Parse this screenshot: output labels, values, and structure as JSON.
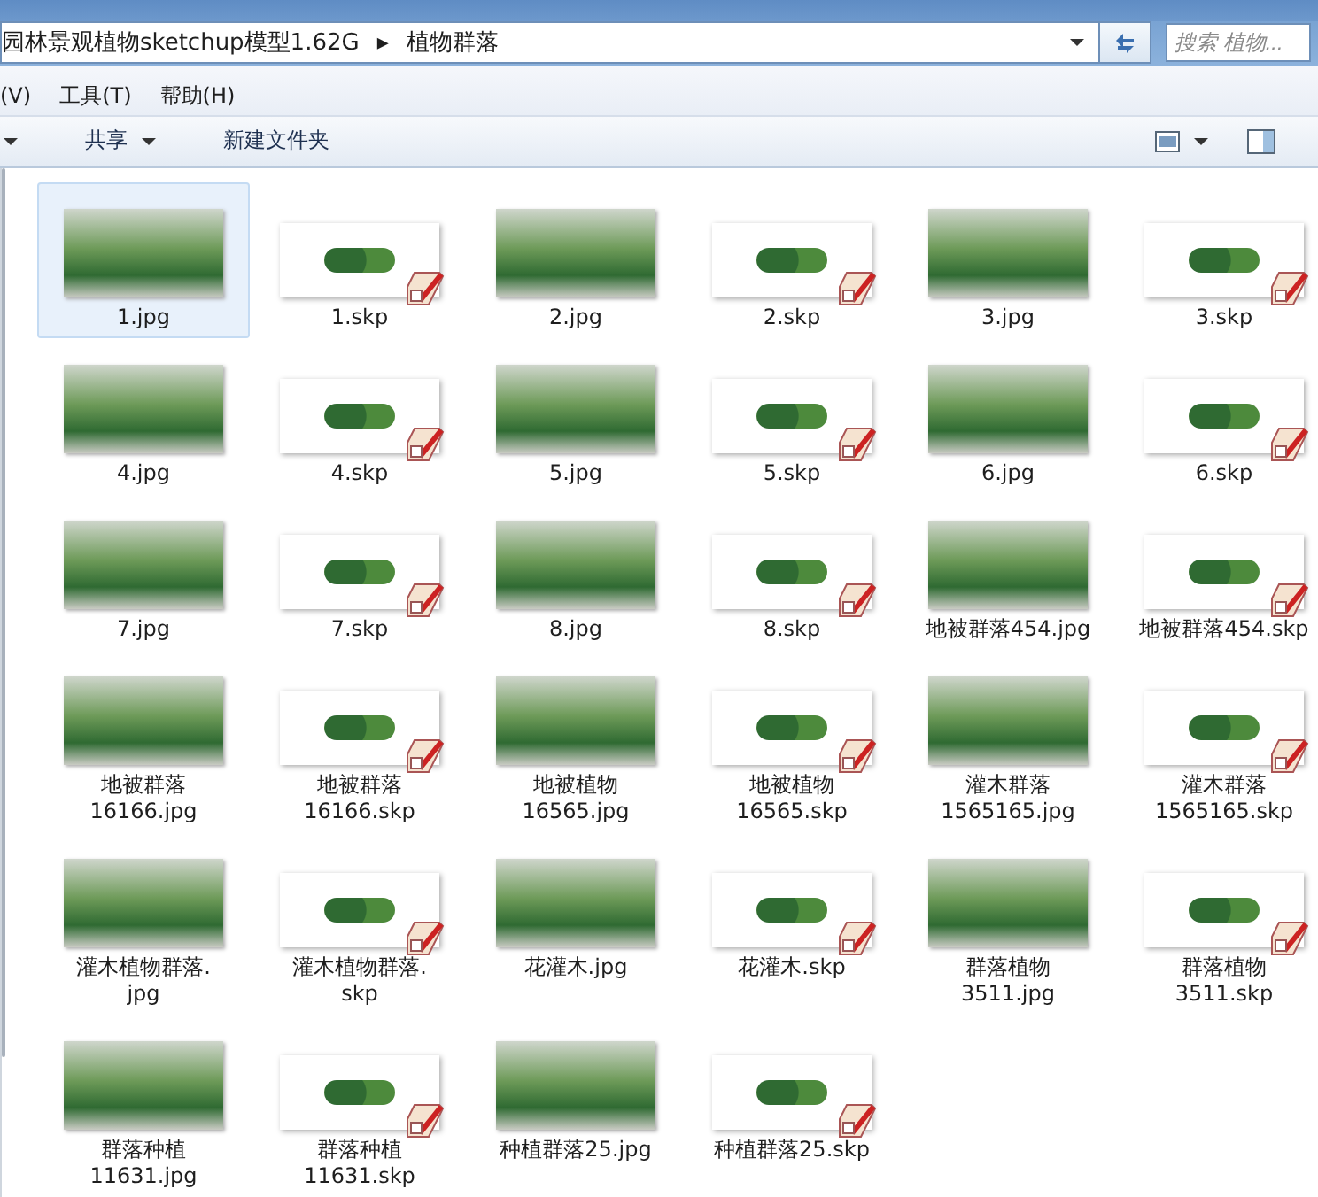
{
  "address_bar": {
    "crumbs": [
      "园林景观植物sketchup模型1.62G",
      "植物群落"
    ],
    "separator": "▸"
  },
  "search": {
    "placeholder": "搜索 植物..."
  },
  "menu_bar": [
    "(V)",
    "工具(T)",
    "帮助(H)"
  ],
  "toolbar": [
    {
      "label": "共享",
      "dropdown": true
    },
    {
      "label": "新建文件夹",
      "dropdown": false
    }
  ],
  "files": [
    {
      "label": "1.jpg",
      "kind": "jpg",
      "selected": true
    },
    {
      "label": "1.skp",
      "kind": "skp",
      "selected": false
    },
    {
      "label": "2.jpg",
      "kind": "jpg",
      "selected": false
    },
    {
      "label": "2.skp",
      "kind": "skp",
      "selected": false
    },
    {
      "label": "3.jpg",
      "kind": "jpg",
      "selected": false
    },
    {
      "label": "3.skp",
      "kind": "skp",
      "selected": false
    },
    {
      "label": "4.jpg",
      "kind": "jpg",
      "selected": false
    },
    {
      "label": "4.skp",
      "kind": "skp",
      "selected": false
    },
    {
      "label": "5.jpg",
      "kind": "jpg",
      "selected": false
    },
    {
      "label": "5.skp",
      "kind": "skp",
      "selected": false
    },
    {
      "label": "6.jpg",
      "kind": "jpg",
      "selected": false
    },
    {
      "label": "6.skp",
      "kind": "skp",
      "selected": false
    },
    {
      "label": "7.jpg",
      "kind": "jpg",
      "selected": false
    },
    {
      "label": "7.skp",
      "kind": "skp",
      "selected": false
    },
    {
      "label": "8.jpg",
      "kind": "jpg",
      "selected": false
    },
    {
      "label": "8.skp",
      "kind": "skp",
      "selected": false
    },
    {
      "label": "地被群落454.jpg",
      "kind": "jpg",
      "selected": false
    },
    {
      "label": "地被群落454.skp",
      "kind": "skp",
      "selected": false
    },
    {
      "label": "地被群落\n16166.jpg",
      "kind": "jpg",
      "selected": false
    },
    {
      "label": "地被群落\n16166.skp",
      "kind": "skp",
      "selected": false
    },
    {
      "label": "地被植物\n16565.jpg",
      "kind": "jpg",
      "selected": false
    },
    {
      "label": "地被植物\n16565.skp",
      "kind": "skp",
      "selected": false
    },
    {
      "label": "灌木群落\n1565165.jpg",
      "kind": "jpg",
      "selected": false
    },
    {
      "label": "灌木群落\n1565165.skp",
      "kind": "skp",
      "selected": false
    },
    {
      "label": "灌木植物群落.\njpg",
      "kind": "jpg",
      "selected": false
    },
    {
      "label": "灌木植物群落.\nskp",
      "kind": "skp",
      "selected": false
    },
    {
      "label": "花灌木.jpg",
      "kind": "jpg",
      "selected": false
    },
    {
      "label": "花灌木.skp",
      "kind": "skp",
      "selected": false
    },
    {
      "label": "群落植物\n3511.jpg",
      "kind": "jpg",
      "selected": false
    },
    {
      "label": "群落植物\n3511.skp",
      "kind": "skp",
      "selected": false
    },
    {
      "label": "群落种植\n11631.jpg",
      "kind": "jpg",
      "selected": false
    },
    {
      "label": "群落种植\n11631.skp",
      "kind": "skp",
      "selected": false
    },
    {
      "label": "种植群落25.jpg",
      "kind": "jpg",
      "selected": false
    },
    {
      "label": "种植群落25.skp",
      "kind": "skp",
      "selected": false
    }
  ]
}
